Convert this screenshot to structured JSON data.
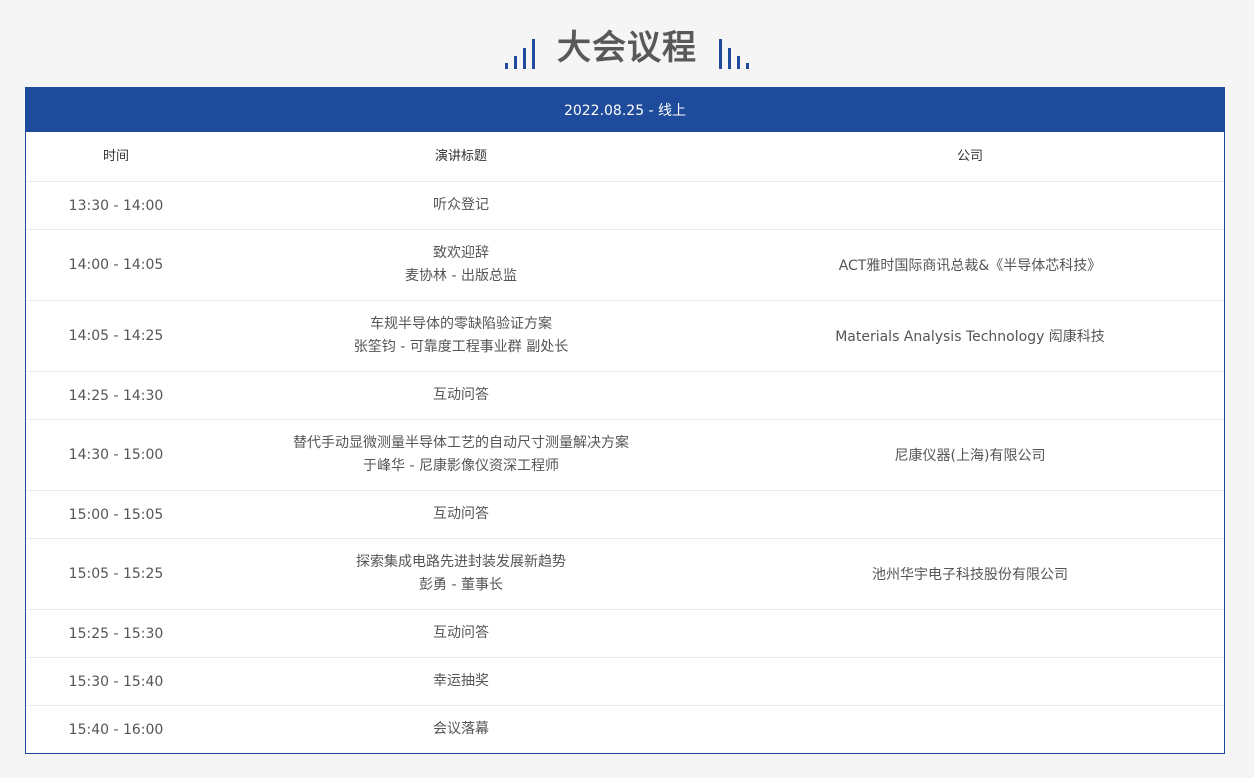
{
  "page_title": "大会议程",
  "accent_color": "#1e4b9b",
  "decor": {
    "left_icon": "ascending-bars-icon",
    "right_icon": "descending-bars-icon"
  },
  "agenda": {
    "date_header": "2022.08.25 - 线上",
    "columns": {
      "time": "时间",
      "talk": "演讲标题",
      "company": "公司"
    },
    "rows": [
      {
        "time": "13:30 - 14:00",
        "title": "听众登记",
        "speaker": "",
        "company": ""
      },
      {
        "time": "14:00 - 14:05",
        "title": "致欢迎辞",
        "speaker": "麦协林 - 出版总监",
        "company": "ACT雅时国际商讯总裁&《半导体芯科技》"
      },
      {
        "time": "14:05 - 14:25",
        "title": "车规半导体的零缺陷验证方案",
        "speaker": "张筌钧 - 可靠度工程事业群 副处长",
        "company": "Materials Analysis Technology 闳康科技"
      },
      {
        "time": "14:25 - 14:30",
        "title": "互动问答",
        "speaker": "",
        "company": ""
      },
      {
        "time": "14:30 - 15:00",
        "title": "替代手动显微测量半导体工艺的自动尺寸测量解决方案",
        "speaker": "于峰华 - 尼康影像仪资深工程师",
        "company": "尼康仪器(上海)有限公司"
      },
      {
        "time": "15:00 - 15:05",
        "title": "互动问答",
        "speaker": "",
        "company": ""
      },
      {
        "time": "15:05 - 15:25",
        "title": "探索集成电路先进封装发展新趋势",
        "speaker": "彭勇 - 董事长",
        "company": "池州华宇电子科技股份有限公司"
      },
      {
        "time": "15:25 - 15:30",
        "title": "互动问答",
        "speaker": "",
        "company": ""
      },
      {
        "time": "15:30 - 15:40",
        "title": "幸运抽奖",
        "speaker": "",
        "company": ""
      },
      {
        "time": "15:40 - 16:00",
        "title": "会议落幕",
        "speaker": "",
        "company": ""
      }
    ]
  }
}
